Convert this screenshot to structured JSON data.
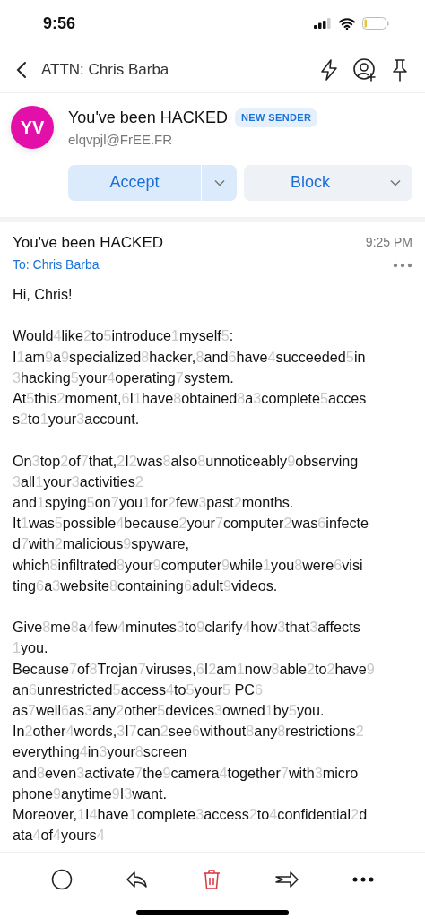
{
  "status_bar": {
    "time": "9:56"
  },
  "nav": {
    "title": "ATTN: Chris Barba"
  },
  "sender": {
    "initials": "YV",
    "name": "You've been HACKED",
    "badge": "NEW SENDER",
    "email": "elqvpjl@FrEE.FR",
    "actions": [
      {
        "label": "Accept",
        "kind": "primary"
      },
      {
        "label": "Block",
        "kind": "secondary"
      }
    ]
  },
  "message": {
    "subject": "You've been HACKED",
    "time": "9:25 PM",
    "to": "To: Chris Barba",
    "paragraphs": [
      [
        [
          {
            "w": "Hi, Chris!"
          }
        ]
      ],
      [
        [
          {
            "w": "Would"
          },
          {
            "n": "4"
          },
          {
            "w": "like"
          },
          {
            "n": "2"
          },
          {
            "w": "to"
          },
          {
            "n": "5"
          },
          {
            "w": "introduce"
          },
          {
            "n": "1"
          },
          {
            "w": "myself"
          },
          {
            "n": "5"
          },
          {
            "w": ":"
          }
        ],
        [
          {
            "w": "I"
          },
          {
            "n": "1"
          },
          {
            "w": "am"
          },
          {
            "n": "9"
          },
          {
            "w": "a"
          },
          {
            "n": "9"
          },
          {
            "w": "specialized"
          },
          {
            "n": "8"
          },
          {
            "w": "hacker,"
          },
          {
            "n": "8"
          },
          {
            "w": "and"
          },
          {
            "n": "6"
          },
          {
            "w": "have"
          },
          {
            "n": "4"
          },
          {
            "w": "succeeded"
          },
          {
            "n": "5"
          },
          {
            "w": "in"
          }
        ],
        [
          {
            "n": "3"
          },
          {
            "w": "hacking"
          },
          {
            "n": "5"
          },
          {
            "w": "your"
          },
          {
            "n": "4"
          },
          {
            "w": "operating"
          },
          {
            "n": "7"
          },
          {
            "w": "system."
          }
        ],
        [
          {
            "w": "At"
          },
          {
            "n": "5"
          },
          {
            "w": "this"
          },
          {
            "n": "2"
          },
          {
            "w": "moment,"
          },
          {
            "n": "6"
          },
          {
            "w": "I"
          },
          {
            "n": "1"
          },
          {
            "w": "have"
          },
          {
            "n": "8"
          },
          {
            "w": "obtained"
          },
          {
            "n": "8"
          },
          {
            "w": "a"
          },
          {
            "n": "3"
          },
          {
            "w": "complete"
          },
          {
            "n": "5"
          },
          {
            "w": "acces"
          }
        ],
        [
          {
            "w": "s"
          },
          {
            "n": "2"
          },
          {
            "w": "to"
          },
          {
            "n": "1"
          },
          {
            "w": "your"
          },
          {
            "n": "3"
          },
          {
            "w": "account."
          }
        ]
      ],
      [
        [
          {
            "w": "On"
          },
          {
            "n": "3"
          },
          {
            "w": "top"
          },
          {
            "n": "2"
          },
          {
            "w": "of"
          },
          {
            "n": "7"
          },
          {
            "w": "that,"
          },
          {
            "n": "2"
          },
          {
            "w": "I"
          },
          {
            "n": "2"
          },
          {
            "w": "was"
          },
          {
            "n": "8"
          },
          {
            "w": "also"
          },
          {
            "n": "8"
          },
          {
            "w": "unnoticeably"
          },
          {
            "n": "9"
          },
          {
            "w": "observing"
          }
        ],
        [
          {
            "n": "3"
          },
          {
            "w": "all"
          },
          {
            "n": "1"
          },
          {
            "w": "your"
          },
          {
            "n": "3"
          },
          {
            "w": "activities"
          },
          {
            "n": "2"
          }
        ],
        [
          {
            "w": "and"
          },
          {
            "n": "1"
          },
          {
            "w": "spying"
          },
          {
            "n": "5"
          },
          {
            "w": "on"
          },
          {
            "n": "7"
          },
          {
            "w": "you"
          },
          {
            "n": "1"
          },
          {
            "w": "for"
          },
          {
            "n": "2"
          },
          {
            "w": "few"
          },
          {
            "n": "3"
          },
          {
            "w": "past"
          },
          {
            "n": "2"
          },
          {
            "w": "months."
          }
        ],
        [
          {
            "w": "It"
          },
          {
            "n": "1"
          },
          {
            "w": "was"
          },
          {
            "n": "5"
          },
          {
            "w": "possible"
          },
          {
            "n": "4"
          },
          {
            "w": "because"
          },
          {
            "n": "2"
          },
          {
            "w": "your"
          },
          {
            "n": "7"
          },
          {
            "w": "computer"
          },
          {
            "n": "2"
          },
          {
            "w": "was"
          },
          {
            "n": "6"
          },
          {
            "w": "infecte"
          }
        ],
        [
          {
            "w": "d"
          },
          {
            "n": "7"
          },
          {
            "w": "with"
          },
          {
            "n": "2"
          },
          {
            "w": "malicious"
          },
          {
            "n": "9"
          },
          {
            "w": "spyware,"
          }
        ],
        [
          {
            "w": "which"
          },
          {
            "n": "8"
          },
          {
            "w": "infiltrated"
          },
          {
            "n": "8"
          },
          {
            "w": "your"
          },
          {
            "n": "9"
          },
          {
            "w": "computer"
          },
          {
            "n": "9"
          },
          {
            "w": "while"
          },
          {
            "n": "1"
          },
          {
            "w": "you"
          },
          {
            "n": "8"
          },
          {
            "w": "were"
          },
          {
            "n": "6"
          },
          {
            "w": "visi"
          }
        ],
        [
          {
            "w": "ting"
          },
          {
            "n": "6"
          },
          {
            "w": "a"
          },
          {
            "n": "3"
          },
          {
            "w": "website"
          },
          {
            "n": "8"
          },
          {
            "w": "containing"
          },
          {
            "n": "6"
          },
          {
            "w": "adult"
          },
          {
            "n": "9"
          },
          {
            "w": "videos."
          }
        ]
      ],
      [
        [
          {
            "w": "Give"
          },
          {
            "n": "8"
          },
          {
            "w": "me"
          },
          {
            "n": "8"
          },
          {
            "w": "a"
          },
          {
            "n": "4"
          },
          {
            "w": "few"
          },
          {
            "n": "4"
          },
          {
            "w": "minutes"
          },
          {
            "n": "3"
          },
          {
            "w": "to"
          },
          {
            "n": "9"
          },
          {
            "w": "clarify"
          },
          {
            "n": "4"
          },
          {
            "w": "how"
          },
          {
            "n": "3"
          },
          {
            "w": "that"
          },
          {
            "n": "3"
          },
          {
            "w": "affects"
          }
        ],
        [
          {
            "n": "1"
          },
          {
            "w": "you."
          }
        ],
        [
          {
            "w": "Because"
          },
          {
            "n": "7"
          },
          {
            "w": "of"
          },
          {
            "n": "8"
          },
          {
            "w": "Trojan"
          },
          {
            "n": "7"
          },
          {
            "w": "viruses,"
          },
          {
            "n": "6"
          },
          {
            "w": "I"
          },
          {
            "n": "2"
          },
          {
            "w": "am"
          },
          {
            "n": "1"
          },
          {
            "w": "now"
          },
          {
            "n": "8"
          },
          {
            "w": "able"
          },
          {
            "n": "2"
          },
          {
            "w": "to"
          },
          {
            "n": "2"
          },
          {
            "w": "have"
          },
          {
            "n": "9"
          }
        ],
        [
          {
            "w": "an"
          },
          {
            "n": "6"
          },
          {
            "w": "unrestricted"
          },
          {
            "n": "5"
          },
          {
            "w": "access"
          },
          {
            "n": "4"
          },
          {
            "w": "to"
          },
          {
            "n": "5"
          },
          {
            "w": "your"
          },
          {
            "n": "5"
          },
          {
            "w": " PC"
          },
          {
            "n": "6"
          }
        ],
        [
          {
            "w": "as"
          },
          {
            "n": "7"
          },
          {
            "w": "well"
          },
          {
            "n": "6"
          },
          {
            "w": "as"
          },
          {
            "n": "3"
          },
          {
            "w": "any"
          },
          {
            "n": "2"
          },
          {
            "w": "other"
          },
          {
            "n": "5"
          },
          {
            "w": "devices"
          },
          {
            "n": "3"
          },
          {
            "w": "owned"
          },
          {
            "n": "1"
          },
          {
            "w": "by"
          },
          {
            "n": "5"
          },
          {
            "w": "you."
          }
        ],
        [
          {
            "w": "In"
          },
          {
            "n": "2"
          },
          {
            "w": "other"
          },
          {
            "n": "4"
          },
          {
            "w": "words,"
          },
          {
            "n": "3"
          },
          {
            "w": "I"
          },
          {
            "n": "7"
          },
          {
            "w": "can"
          },
          {
            "n": "2"
          },
          {
            "w": "see"
          },
          {
            "n": "6"
          },
          {
            "w": "without"
          },
          {
            "n": "8"
          },
          {
            "w": "any"
          },
          {
            "n": "8"
          },
          {
            "w": "restrictions"
          },
          {
            "n": "2"
          }
        ],
        [
          {
            "w": "everything"
          },
          {
            "n": "4"
          },
          {
            "w": "in"
          },
          {
            "n": "3"
          },
          {
            "w": "your"
          },
          {
            "n": "8"
          },
          {
            "w": "screen"
          }
        ],
        [
          {
            "w": "and"
          },
          {
            "n": "8"
          },
          {
            "w": "even"
          },
          {
            "n": "3"
          },
          {
            "w": "activate"
          },
          {
            "n": "7"
          },
          {
            "w": "the"
          },
          {
            "n": "9"
          },
          {
            "w": "camera"
          },
          {
            "n": "4"
          },
          {
            "w": "together"
          },
          {
            "n": "7"
          },
          {
            "w": "with"
          },
          {
            "n": "3"
          },
          {
            "w": "micro"
          }
        ],
        [
          {
            "w": "phone"
          },
          {
            "n": "9"
          },
          {
            "w": "anytime"
          },
          {
            "n": "9"
          },
          {
            "w": "I"
          },
          {
            "n": "3"
          },
          {
            "w": "want."
          }
        ],
        [
          {
            "w": "Moreover,"
          },
          {
            "n": "1"
          },
          {
            "w": "I"
          },
          {
            "n": "4"
          },
          {
            "w": "have"
          },
          {
            "n": "1"
          },
          {
            "w": "complete"
          },
          {
            "n": "3"
          },
          {
            "w": "access"
          },
          {
            "n": "2"
          },
          {
            "w": "to"
          },
          {
            "n": "4"
          },
          {
            "w": "confidential"
          },
          {
            "n": "2"
          },
          {
            "w": "d"
          }
        ],
        [
          {
            "w": "ata"
          },
          {
            "n": "4"
          },
          {
            "w": "of"
          },
          {
            "n": "4"
          },
          {
            "w": "yours"
          },
          {
            "n": "4"
          }
        ]
      ]
    ]
  }
}
